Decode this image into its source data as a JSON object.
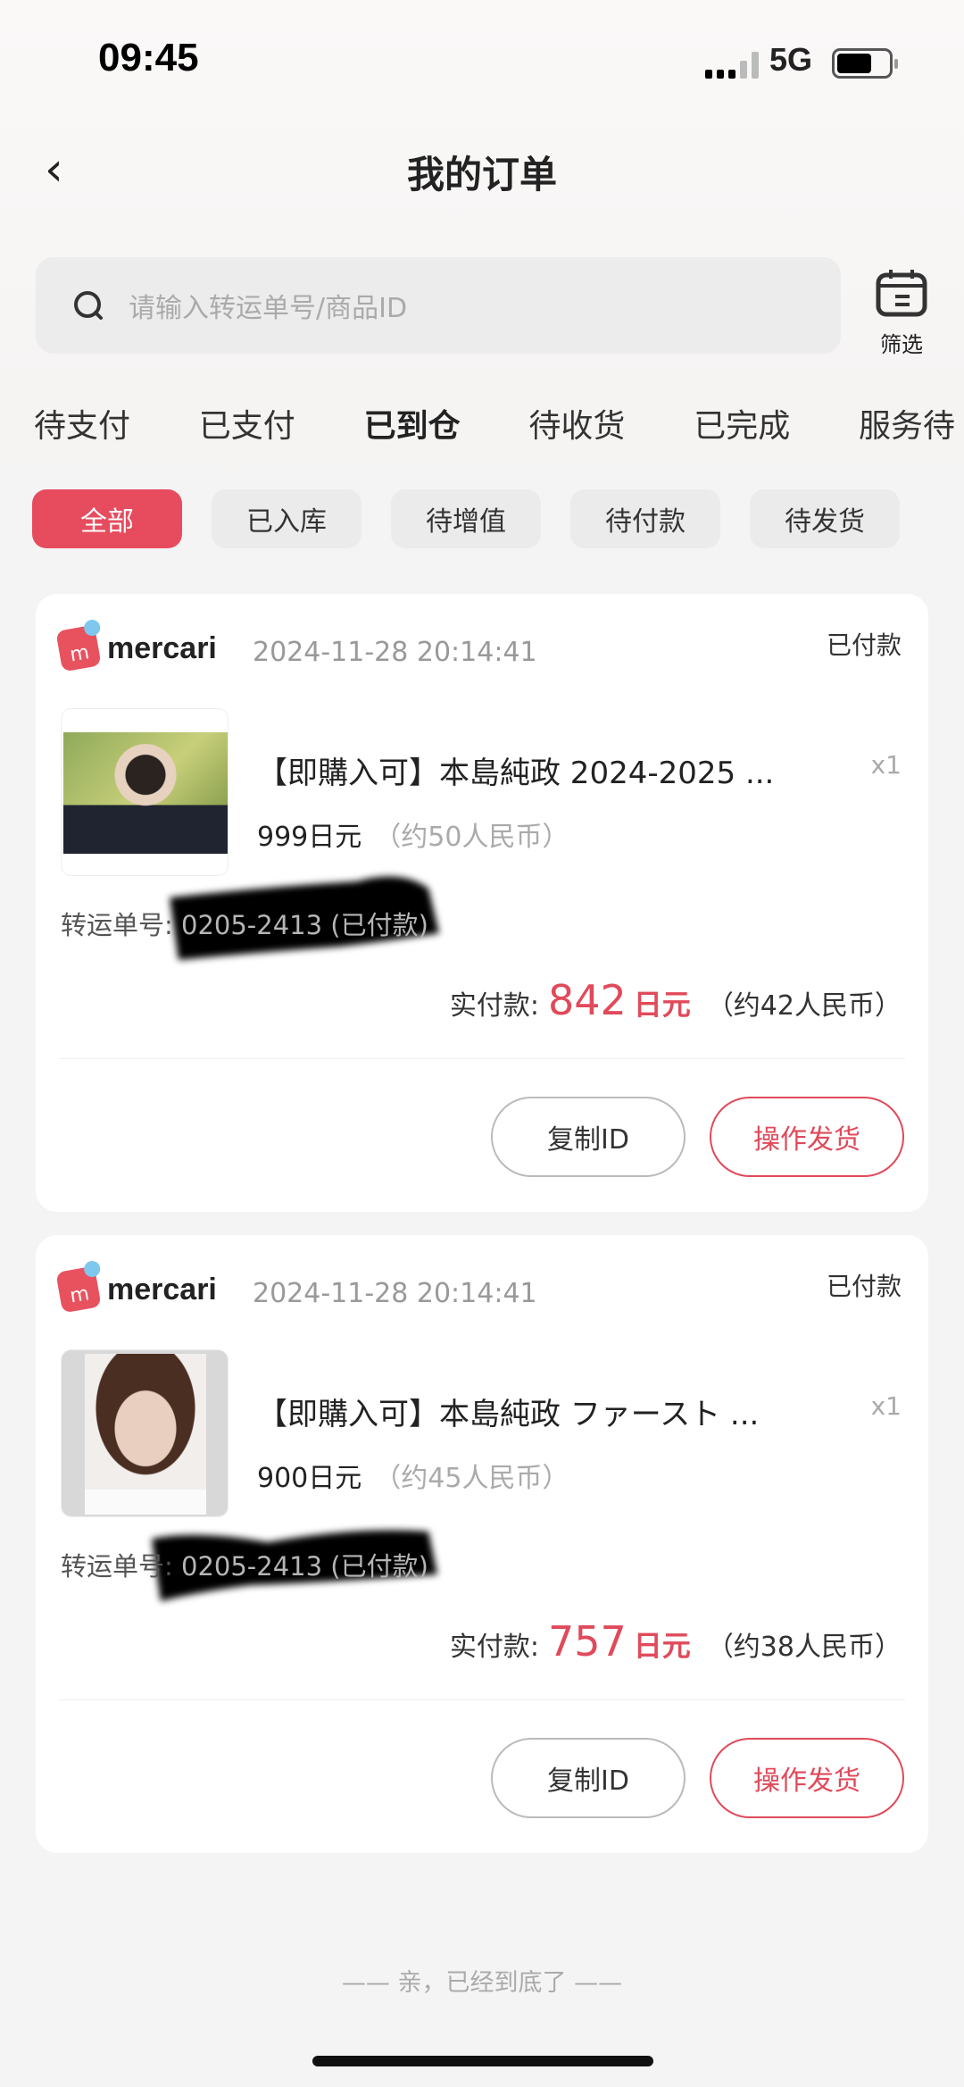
{
  "status_bar": {
    "time": "09:45",
    "network": "5G"
  },
  "header": {
    "title": "我的订单"
  },
  "search": {
    "placeholder": "请输入转运单号/商品ID",
    "filter_label": "筛选"
  },
  "tabs": [
    {
      "label": "待支付"
    },
    {
      "label": "已支付"
    },
    {
      "label": "已到仓",
      "active": true
    },
    {
      "label": "待收货"
    },
    {
      "label": "已完成"
    },
    {
      "label": "服务待"
    }
  ],
  "chips": [
    {
      "label": "全部",
      "active": true
    },
    {
      "label": "已入库"
    },
    {
      "label": "待增值"
    },
    {
      "label": "待付款"
    },
    {
      "label": "待发货"
    }
  ],
  "colors": {
    "accent": "#e64c5e",
    "price": "#e04a5a"
  },
  "orders": [
    {
      "platform": "mercari",
      "date": "2024-11-28 20:14:41",
      "status": "已付款",
      "product": "【即購入可】本島純政 2024-2025 ...",
      "qty": "x1",
      "price": "999日元",
      "price_cny": "（约50人民币）",
      "tracking_label": "转运单号:",
      "tracking_value": "0205-2413",
      "tracking_status": "(已付款)",
      "total_label": "实付款:",
      "total_amount": "842",
      "total_unit": "日元",
      "total_cny": "（约42人民币）",
      "copy_label": "复制ID",
      "ship_label": "操作发货"
    },
    {
      "platform": "mercari",
      "date": "2024-11-28 20:14:41",
      "status": "已付款",
      "product": "【即購入可】本島純政 ファースト ...",
      "qty": "x1",
      "price": "900日元",
      "price_cny": "（约45人民币）",
      "tracking_label": "转运单号:",
      "tracking_value": "0205-2413",
      "tracking_status": "(已付款)",
      "total_label": "实付款:",
      "total_amount": "757",
      "total_unit": "日元",
      "total_cny": "（约38人民币）",
      "copy_label": "复制ID",
      "ship_label": "操作发货"
    }
  ],
  "footer": "—— 亲，已经到底了 ——"
}
